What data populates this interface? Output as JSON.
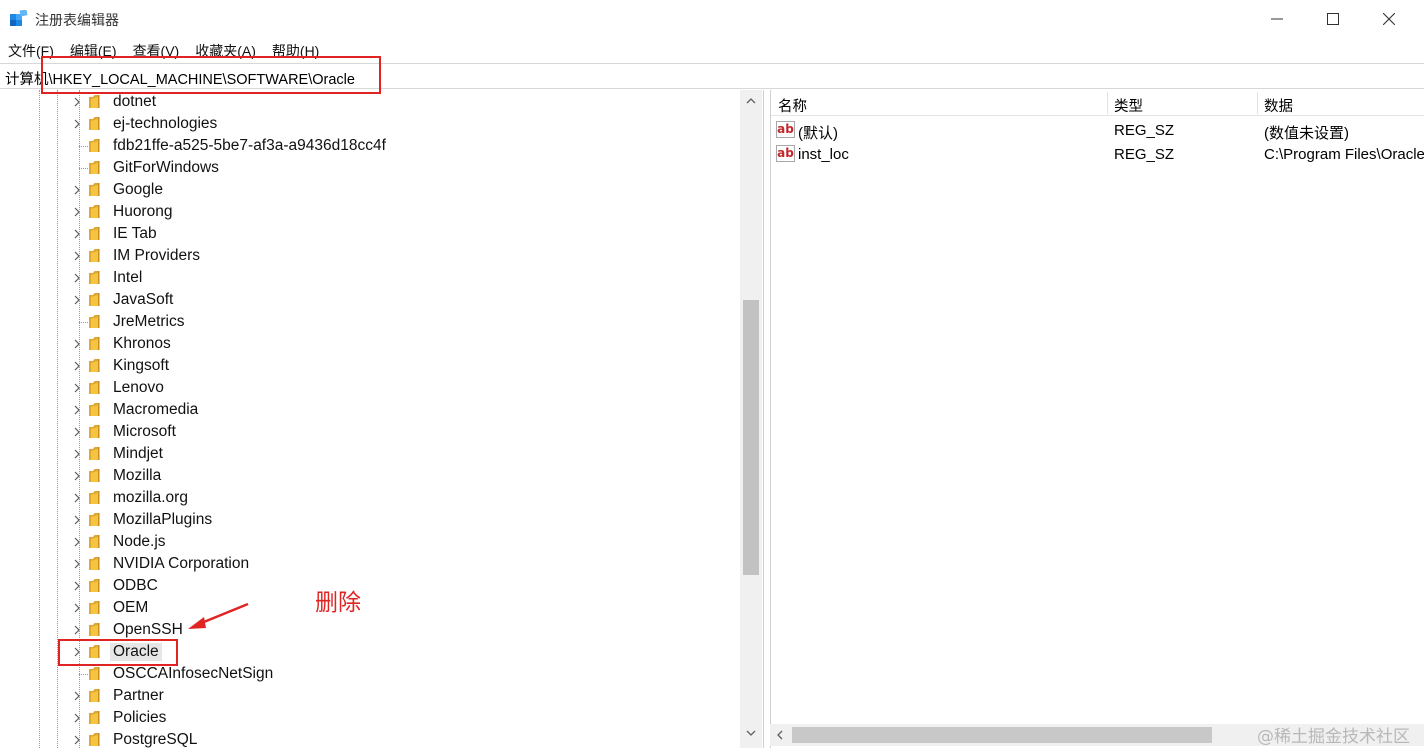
{
  "window": {
    "title": "注册表编辑器"
  },
  "menu": [
    {
      "label": "文件(F)"
    },
    {
      "label": "编辑(E)"
    },
    {
      "label": "查看(V)"
    },
    {
      "label": "收藏夹(A)"
    },
    {
      "label": "帮助(H)"
    }
  ],
  "address": {
    "path": "计算机\\HKEY_LOCAL_MACHINE\\SOFTWARE\\Oracle"
  },
  "tree": {
    "items": [
      {
        "label": "dotnet",
        "expandable": true,
        "selected": false
      },
      {
        "label": "ej-technologies",
        "expandable": true,
        "selected": false
      },
      {
        "label": "fdb21ffe-a525-5be7-af3a-a9436d18cc4f",
        "expandable": false,
        "selected": false
      },
      {
        "label": "GitForWindows",
        "expandable": false,
        "selected": false
      },
      {
        "label": "Google",
        "expandable": true,
        "selected": false
      },
      {
        "label": "Huorong",
        "expandable": true,
        "selected": false
      },
      {
        "label": "IE Tab",
        "expandable": true,
        "selected": false
      },
      {
        "label": "IM Providers",
        "expandable": true,
        "selected": false
      },
      {
        "label": "Intel",
        "expandable": true,
        "selected": false
      },
      {
        "label": "JavaSoft",
        "expandable": true,
        "selected": false
      },
      {
        "label": "JreMetrics",
        "expandable": false,
        "selected": false
      },
      {
        "label": "Khronos",
        "expandable": true,
        "selected": false
      },
      {
        "label": "Kingsoft",
        "expandable": true,
        "selected": false
      },
      {
        "label": "Lenovo",
        "expandable": true,
        "selected": false
      },
      {
        "label": "Macromedia",
        "expandable": true,
        "selected": false
      },
      {
        "label": "Microsoft",
        "expandable": true,
        "selected": false
      },
      {
        "label": "Mindjet",
        "expandable": true,
        "selected": false
      },
      {
        "label": "Mozilla",
        "expandable": true,
        "selected": false
      },
      {
        "label": "mozilla.org",
        "expandable": true,
        "selected": false
      },
      {
        "label": "MozillaPlugins",
        "expandable": true,
        "selected": false
      },
      {
        "label": "Node.js",
        "expandable": true,
        "selected": false
      },
      {
        "label": "NVIDIA Corporation",
        "expandable": true,
        "selected": false
      },
      {
        "label": "ODBC",
        "expandable": true,
        "selected": false
      },
      {
        "label": "OEM",
        "expandable": true,
        "selected": false
      },
      {
        "label": "OpenSSH",
        "expandable": true,
        "selected": false
      },
      {
        "label": "Oracle",
        "expandable": true,
        "selected": true
      },
      {
        "label": "OSCCAInfosecNetSign",
        "expandable": false,
        "selected": false
      },
      {
        "label": "Partner",
        "expandable": true,
        "selected": false
      },
      {
        "label": "Policies",
        "expandable": true,
        "selected": false
      },
      {
        "label": "PostgreSQL",
        "expandable": true,
        "selected": false
      }
    ]
  },
  "annotation": {
    "text": "删除",
    "color": "#e02424"
  },
  "list": {
    "columns": {
      "name": "名称",
      "type": "类型",
      "data": "数据"
    },
    "rows": [
      {
        "icon": "ab",
        "name": "(默认)",
        "type": "REG_SZ",
        "data": "(数值未设置)"
      },
      {
        "icon": "ab",
        "name": "inst_loc",
        "type": "REG_SZ",
        "data": "C:\\Program Files\\Oracle"
      }
    ]
  },
  "watermark": "@稀土掘金技术社区",
  "colors": {
    "highlight": "#e02424",
    "folder": "#f5c542",
    "selection": "#e6e6e6"
  }
}
